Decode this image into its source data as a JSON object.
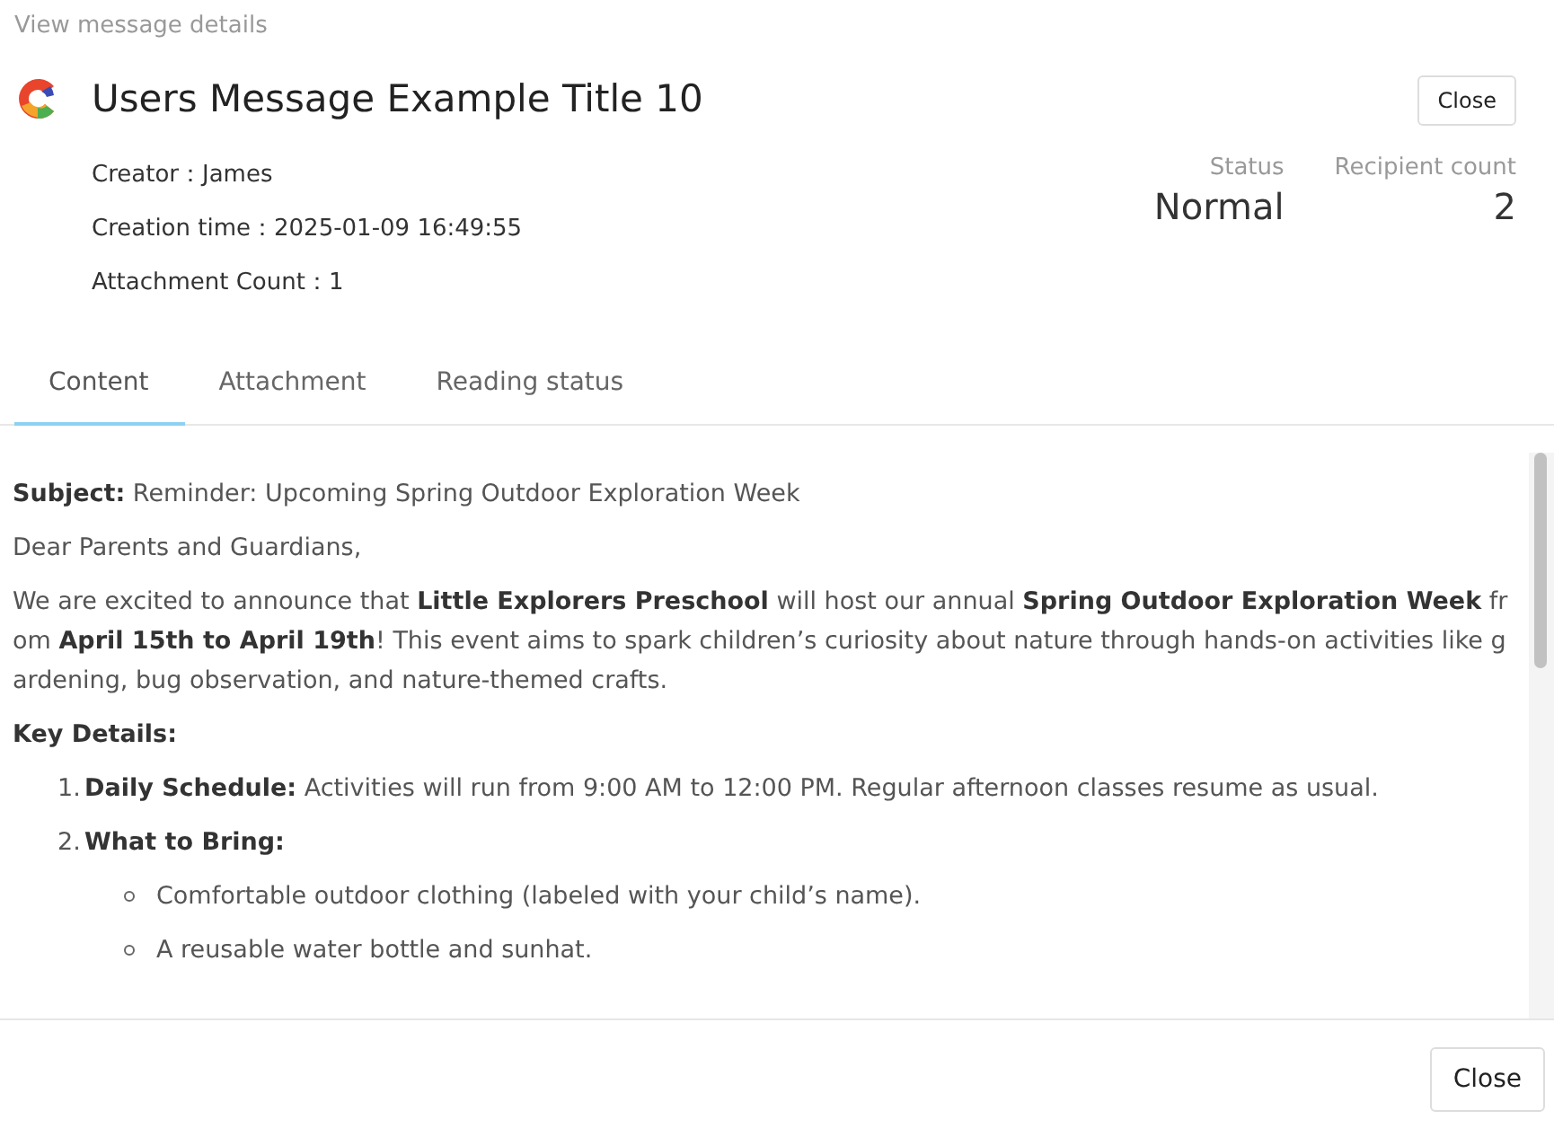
{
  "dialog_title": "View message details",
  "message": {
    "title": "Users Message Example Title 10",
    "meta": [
      {
        "label": "Creator：",
        "value": "James"
      },
      {
        "label": "Creation time：",
        "value": "2025-01-09 16:49:55"
      },
      {
        "label": "Attachment Count：",
        "value": "1"
      }
    ],
    "stats": [
      {
        "label": "Status",
        "value": "Normal"
      },
      {
        "label": "Recipient count",
        "value": "2"
      }
    ]
  },
  "header_button": "Close",
  "tabs": [
    {
      "label": "Content",
      "selected": true
    },
    {
      "label": "Attachment",
      "selected": false
    },
    {
      "label": "Reading status",
      "selected": false
    }
  ],
  "content": [
    {
      "kind": "paragraph",
      "text": "**Subject:** Reminder: Upcoming Spring Outdoor Exploration Week"
    },
    {
      "kind": "paragraph",
      "text": "Dear Parents and Guardians,"
    },
    {
      "kind": "paragraph",
      "text": "We are excited to announce that **Little Explorers Preschool** will host our annual **Spring Outdoor Exploration Week** from **April 15th to April 19th**! This event aims to spark children’s curiosity about nature through hands-on activities like gardening, bug observation, and nature-themed crafts."
    },
    {
      "kind": "heading",
      "text": "Key Details:"
    },
    {
      "kind": "numbered",
      "number": "1.",
      "text": "**Daily Schedule:** Activities will run from 9:00 AM to 12:00 PM. Regular afternoon classes resume as usual."
    },
    {
      "kind": "numbered",
      "number": "2.",
      "text": "**What to Bring:**"
    },
    {
      "kind": "bullet",
      "text": "Comfortable outdoor clothing (labeled with your child’s name)."
    },
    {
      "kind": "bullet",
      "text": "A reusable water bottle and sunhat."
    }
  ],
  "footer_button": "Close"
}
